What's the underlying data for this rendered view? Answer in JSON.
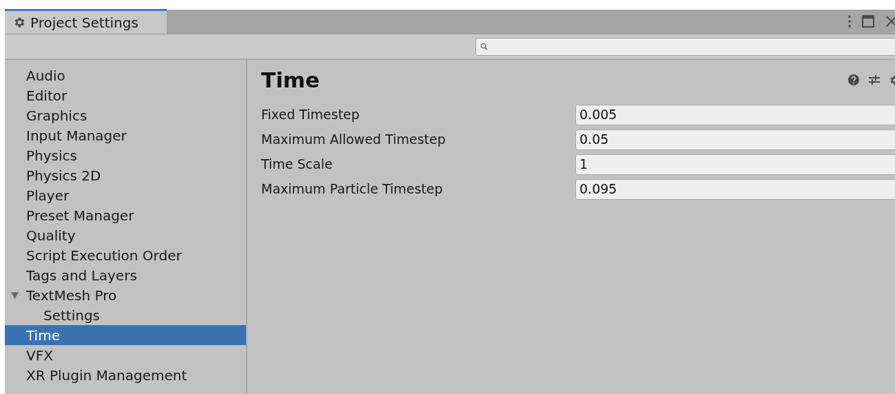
{
  "window": {
    "tab_title": "Project Settings"
  },
  "sidebar": {
    "items": [
      {
        "label": "Audio",
        "selected": false
      },
      {
        "label": "Editor",
        "selected": false
      },
      {
        "label": "Graphics",
        "selected": false
      },
      {
        "label": "Input Manager",
        "selected": false
      },
      {
        "label": "Physics",
        "selected": false
      },
      {
        "label": "Physics 2D",
        "selected": false
      },
      {
        "label": "Player",
        "selected": false
      },
      {
        "label": "Preset Manager",
        "selected": false
      },
      {
        "label": "Quality",
        "selected": false
      },
      {
        "label": "Script Execution Order",
        "selected": false
      },
      {
        "label": "Tags and Layers",
        "selected": false
      },
      {
        "label": "TextMesh Pro",
        "selected": false,
        "expanded": true,
        "children": [
          {
            "label": "Settings",
            "selected": false
          }
        ]
      },
      {
        "label": "Time",
        "selected": true
      },
      {
        "label": "VFX",
        "selected": false
      },
      {
        "label": "XR Plugin Management",
        "selected": false
      }
    ]
  },
  "panel": {
    "title": "Time",
    "fields": [
      {
        "label": "Fixed Timestep",
        "value": "0.005"
      },
      {
        "label": "Maximum Allowed Timestep",
        "value": "0.05"
      },
      {
        "label": "Time Scale",
        "value": "1"
      },
      {
        "label": "Maximum Particle Timestep",
        "value": "0.095"
      }
    ]
  }
}
